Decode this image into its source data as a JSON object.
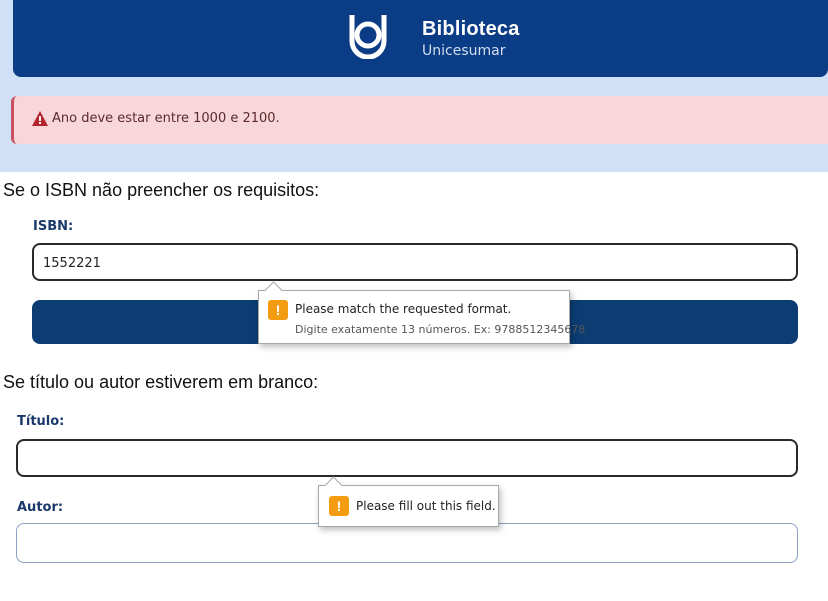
{
  "header": {
    "brand_title": "Biblioteca",
    "brand_subtitle": "Unicesumar",
    "logo_icon": "unicesumar-logo-icon"
  },
  "alert": {
    "icon": "warning-triangle-icon",
    "message": "Ano deve estar entre 1000 e 2100."
  },
  "captions": {
    "isbn": "Se o ISBN não preencher os requisitos:",
    "title_author": "Se título ou autor estiverem em branco:"
  },
  "isbn_form": {
    "label": "ISBN:",
    "value": "1552221",
    "tooltip_title": "Please match the requested format.",
    "tooltip_detail": "Digite exatamente 13 números. Ex: 9788512345678"
  },
  "book_form": {
    "title_label": "Título:",
    "title_value": "",
    "author_label": "Autor:",
    "author_value": "",
    "tooltip": "Please fill out this field."
  },
  "colors": {
    "header_bg": "#0b3d86",
    "alert_bg": "#f8d7da",
    "warning_icon": "#f39c12"
  }
}
